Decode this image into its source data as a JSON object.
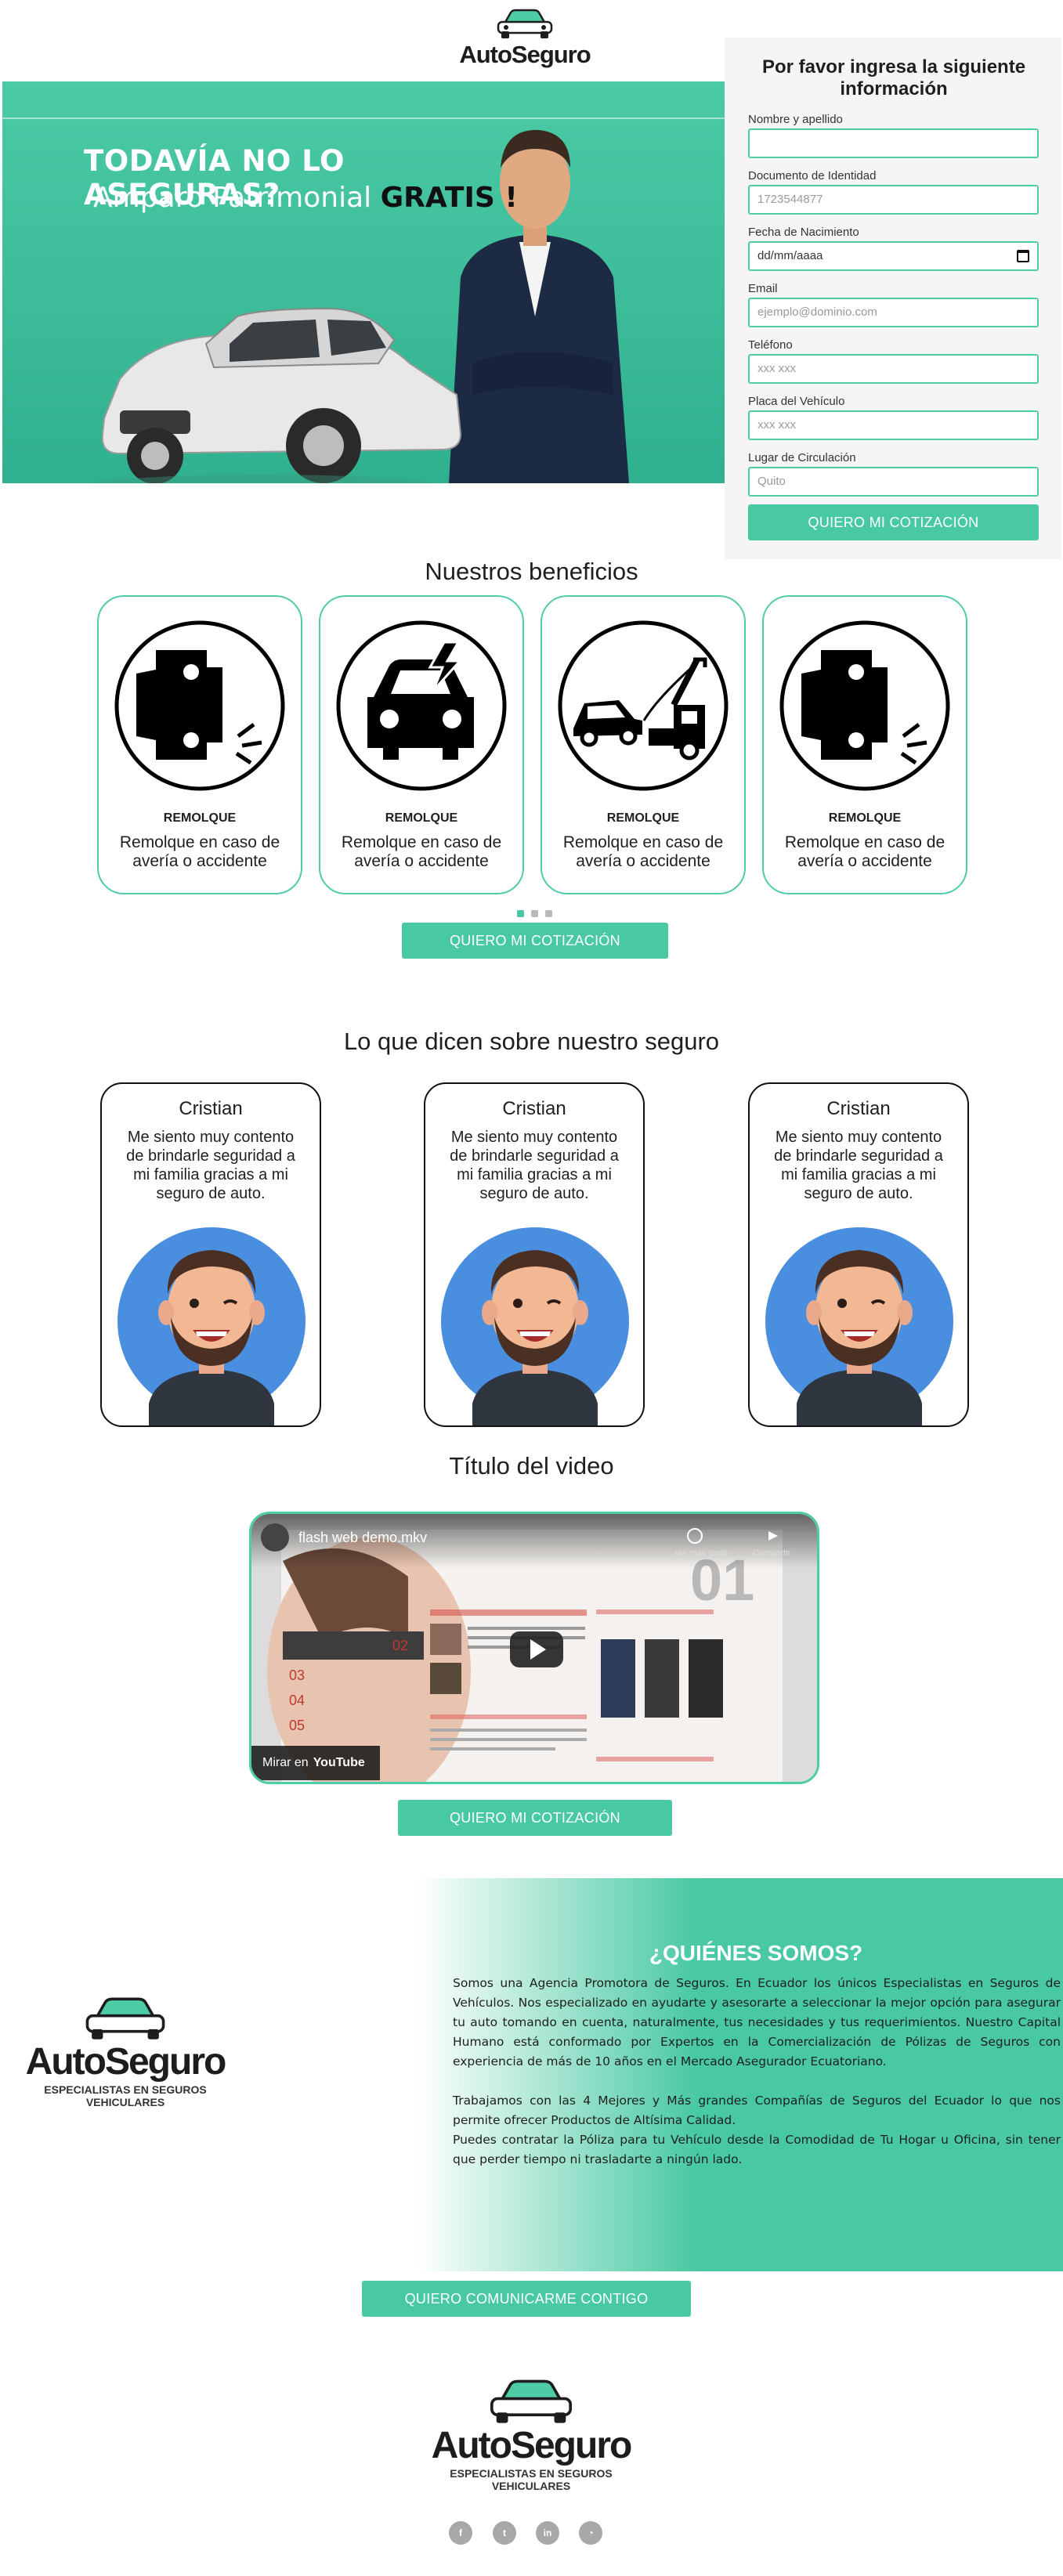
{
  "header": {
    "brand": "AutoSeguro"
  },
  "hero": {
    "headline": "TODAVÍA NO LO ASEGURAS?",
    "sub_prefix": "Amparo Patrimonial ",
    "sub_bold": "GRATIS !"
  },
  "form": {
    "title": "Por favor ingresa la siguiente información",
    "fields": [
      {
        "label": "Nombre y apellido",
        "placeholder": ""
      },
      {
        "label": "Documento de Identidad",
        "placeholder": "1723544877"
      },
      {
        "label": "Fecha de Nacimiento",
        "placeholder": "dd/mm/aaaa"
      },
      {
        "label": "Email",
        "placeholder": "ejemplo@dominio.com"
      },
      {
        "label": "Teléfono",
        "placeholder": "xxx xxx"
      },
      {
        "label": "Placa del Vehículo",
        "placeholder": "xxx xxx"
      },
      {
        "label": "Lugar de Circulación",
        "placeholder": "Quito"
      }
    ],
    "submit_label": "QUIERO MI COTIZACIÓN"
  },
  "benefits": {
    "title": "Nuestros beneficios",
    "items": [
      {
        "icon": "car-crash-icon",
        "label": "REMOLQUE",
        "desc": "Remolque en caso de avería o accidente"
      },
      {
        "icon": "car-electric-fault-icon",
        "label": "REMOLQUE",
        "desc": "Remolque en caso de avería o accidente"
      },
      {
        "icon": "tow-truck-icon",
        "label": "REMOLQUE",
        "desc": "Remolque en caso de avería o accidente"
      },
      {
        "icon": "car-crash-icon",
        "label": "REMOLQUE",
        "desc": "Remolque en caso de avería o accidente"
      }
    ],
    "cta_label": "QUIERO MI COTIZACIÓN"
  },
  "testimonials": {
    "title": "Lo que dicen sobre nuestro seguro",
    "items": [
      {
        "name": "Cristian",
        "text": "Me siento muy contento de brindarle seguridad a mi familia gracias a mi seguro de auto."
      },
      {
        "name": "Cristian",
        "text": "Me siento muy contento de brindarle seguridad a mi familia gracias a mi seguro de auto."
      },
      {
        "name": "Cristian",
        "text": "Me siento muy contento de brindarle seguridad a mi familia gracias a mi seguro de auto."
      }
    ]
  },
  "video": {
    "section_title": "Título del video",
    "file_title": "flash web demo.mkv",
    "watch_later": "Ver más tarde",
    "share": "Compartir",
    "watch_on": "Mirar en",
    "platform": "YouTube",
    "cta_label": "QUIERO MI COTIZACIÓN"
  },
  "about": {
    "title": "¿QUIÉNES SOMOS?",
    "logo_brand": "AutoSeguro",
    "logo_tagline": "ESPECIALISTAS EN SEGUROS VEHICULARES",
    "p1": "Somos una Agencia Promotora de Seguros. En Ecuador los únicos Especialistas en Seguros de Vehículos. Nos especializado en ayudarte y asesorarte a seleccionar la mejor opción para asegurar tu auto tomando en cuenta, naturalmente, tus necesidades y tus requerimientos. Nuestro Capital Humano está conformado por Expertos en la Comercialización de Pólizas de Seguros con experiencia de más de 10 años en el Mercado Asegurador Ecuatoriano.",
    "p2": "Trabajamos con las 4 Mejores y Más grandes Compañías de Seguros del Ecuador lo que nos permite ofrecer Productos de Altísima Calidad.",
    "p3": "Puedes contratar la Póliza para tu Vehículo desde la Comodidad de Tu Hogar u Oficina, sin tener que perder tiempo ni trasladarte a ningún lado.",
    "cta_label": "QUIERO COMUNICARME CONTIGO"
  },
  "footer": {
    "brand": "AutoSeguro",
    "tagline": "ESPECIALISTAS EN SEGUROS VEHICULARES",
    "social": [
      {
        "icon": "facebook-icon",
        "glyph": "f"
      },
      {
        "icon": "twitter-icon",
        "glyph": "t"
      },
      {
        "icon": "linkedin-icon",
        "glyph": "in"
      },
      {
        "icon": "rss-icon",
        "glyph": "◔"
      }
    ]
  },
  "colors": {
    "accent": "#48c9a3",
    "accent_dark": "#2fb08e",
    "text": "#1f1f1f"
  }
}
